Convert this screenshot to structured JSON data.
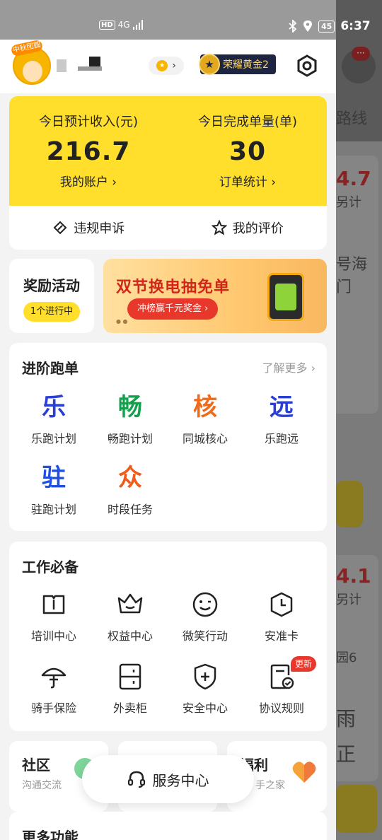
{
  "status_bar": {
    "network": "4G",
    "hd": "HD",
    "battery": "45",
    "time": "6:37"
  },
  "background_app": {
    "route_text": "路线",
    "amount_1": "4.7",
    "extra_1": "另计",
    "addr_1a": "号海",
    "addr_1b": "门",
    "amount_2": "4.1",
    "extra_2": "另计",
    "addr_2": "园6",
    "bottom_chars": [
      "雨",
      "正"
    ],
    "notification_count": "···"
  },
  "profile": {
    "avatar_tag": "中秋团圆",
    "rank_label": "荣耀黄金2"
  },
  "earnings": {
    "income_label": "今日预计收入(元)",
    "income_value": "216.7",
    "income_link": "我的账户",
    "orders_label": "今日完成单量(单)",
    "orders_value": "30",
    "orders_link": "订单统计",
    "appeal_label": "违规申诉",
    "review_label": "我的评价"
  },
  "reward": {
    "title": "奖励活动",
    "badge": "1个进行中"
  },
  "banner": {
    "title": "双节换电抽免单",
    "button": "冲榜赢千元奖金"
  },
  "advanced": {
    "title": "进阶跑单",
    "more": "了解更多",
    "items": [
      {
        "char": "乐",
        "label": "乐跑计划",
        "color": "#2a3fd4"
      },
      {
        "char": "畅",
        "label": "畅跑计划",
        "color": "#12a14b"
      },
      {
        "char": "核",
        "label": "同城核心",
        "color": "#f06a1a"
      },
      {
        "char": "远",
        "label": "乐跑远",
        "color": "#2a3fd4"
      },
      {
        "char": "驻",
        "label": "驻跑计划",
        "color": "#1f4fe0"
      },
      {
        "char": "众",
        "label": "时段任务",
        "color": "#f05a1a"
      }
    ]
  },
  "essentials": {
    "title": "工作必备",
    "items": [
      {
        "icon": "book-icon",
        "label": "培训中心"
      },
      {
        "icon": "crown-icon",
        "label": "权益中心"
      },
      {
        "icon": "smile-icon",
        "label": "微笑行动"
      },
      {
        "icon": "clock-shield-icon",
        "label": "安准卡"
      },
      {
        "icon": "umbrella-icon",
        "label": "骑手保险"
      },
      {
        "icon": "cabinet-icon",
        "label": "外卖柜"
      },
      {
        "icon": "shield-plus-icon",
        "label": "安全中心"
      },
      {
        "icon": "document-check-icon",
        "label": "协议规则"
      }
    ],
    "new_badge": "更新"
  },
  "community": {
    "title": "社区",
    "subtitle": "沟通交流"
  },
  "welfare": {
    "title": "福利",
    "subtitle": "手之家"
  },
  "service_center": {
    "label": "服务中心"
  },
  "more_functions": {
    "title": "更多功能"
  }
}
